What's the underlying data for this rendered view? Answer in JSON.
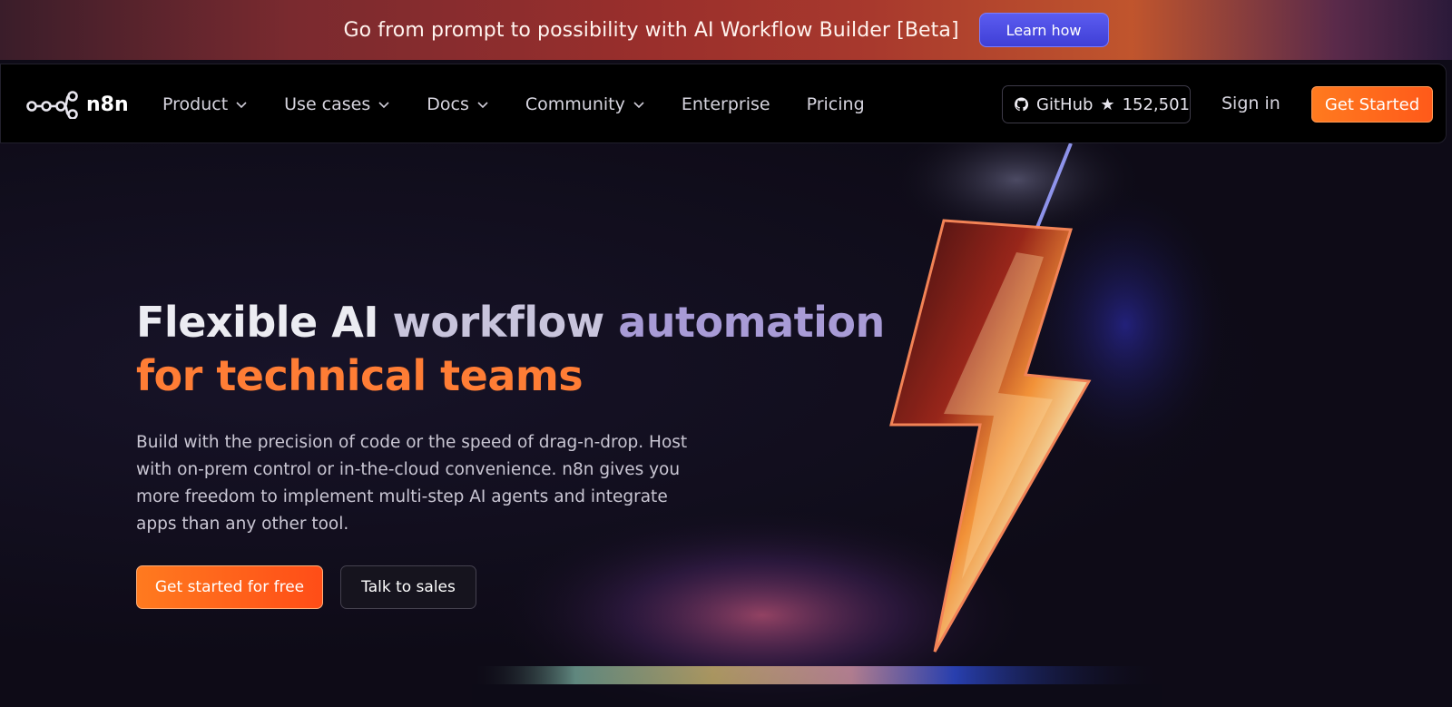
{
  "banner": {
    "text": "Go from prompt to possibility with AI Workflow Builder [Beta]",
    "button_label": "Learn how"
  },
  "nav": {
    "logo_text": "n8n",
    "items": [
      {
        "label": "Product",
        "icon": "chevron-down-icon"
      },
      {
        "label": "Use cases",
        "icon": "chevron-down-icon"
      },
      {
        "label": "Docs",
        "icon": "chevron-down-icon"
      },
      {
        "label": "Community",
        "icon": "chevron-down-icon"
      },
      {
        "label": "Enterprise"
      },
      {
        "label": "Pricing"
      }
    ],
    "github": {
      "label": "GitHub",
      "star": "★",
      "count": "152,501",
      "icon": "github-icon"
    },
    "signin_label": "Sign in",
    "getstarted_label": "Get Started"
  },
  "hero": {
    "headline_part1": "Flexible AI",
    "headline_part2": "workflow",
    "headline_part3": "automation",
    "headline_line2": "for technical teams",
    "description": "Build with the precision of code or the speed of drag-n-drop. Host with on-prem control or in-the-cloud convenience. n8n gives you more freedom to implement multi-step AI agents and integrate apps than any other tool.",
    "cta_primary": "Get started for free",
    "cta_secondary": "Talk to sales",
    "art_icon": "lightning-bolt-illustration"
  },
  "colors": {
    "accent_orange": "#ff6a1f",
    "banner_button": "#4b4be6",
    "headline_purple": "#a89bd6",
    "background": "#0e0b17"
  }
}
